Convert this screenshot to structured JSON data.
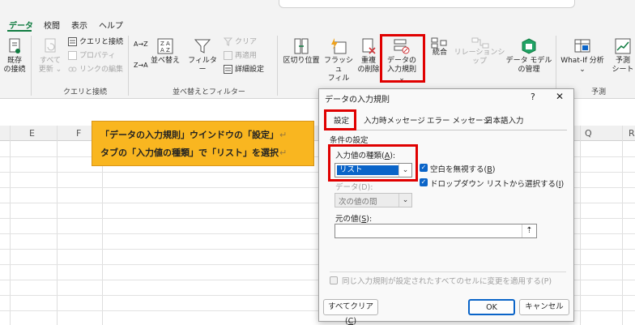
{
  "search": {
    "placeholder": ""
  },
  "tabs": [
    {
      "label": "データ",
      "active": true
    },
    {
      "label": "校閲"
    },
    {
      "label": "表示"
    },
    {
      "label": "ヘルプ"
    }
  ],
  "ribbon": {
    "existing": {
      "line1": "既存",
      "line2": "の接続"
    },
    "refresh_all": {
      "line1": "すべて",
      "line2": "更新 ⌄"
    },
    "queries_connections": "クエリと接続",
    "properties": "プロパティ",
    "edit_links": "リンクの編集",
    "group_queries": "クエリと接続",
    "sort_az": "A→Z",
    "sort_za": "Z→A",
    "sort": "並べ替え",
    "filter": "フィルター",
    "clear": "クリア",
    "reapply": "再適用",
    "advanced": "詳細設定",
    "group_sort": "並べ替えとフィルター",
    "text_to_columns": "区切り位置",
    "flash_fill": {
      "line1": "フラッシュ",
      "line2": "フィル"
    },
    "remove_dup": {
      "line1": "重複",
      "line2": "の削除"
    },
    "data_validation": {
      "line1": "データの",
      "line2": "入力規則 ⌄"
    },
    "consolidate": "統合",
    "relationships": "リレーションシップ",
    "data_model": {
      "line1": "データ モデル",
      "line2": "の管理"
    },
    "whatif": {
      "line1": "What-If 分析",
      "line2": "⌄"
    },
    "forecast": {
      "line1": "予測",
      "line2": "シート"
    },
    "group_forecast": "予測"
  },
  "columns": [
    "E",
    "F",
    "Q",
    "R"
  ],
  "callout": {
    "line1": "「データの入力規則」ウインドウの「設定」",
    "line2": "タブの「入力値の種類」で「リスト」を選択",
    "return_mark": "↵"
  },
  "dialog": {
    "title": "データの入力規則",
    "help": "?",
    "close": "✕",
    "tabs": [
      "設定",
      "入力時メッセージ",
      "エラー メッセージ",
      "日本語入力"
    ],
    "section": "条件の設定",
    "allow_label": "入力値の種類(",
    "allow_key": "A",
    "allow_suffix": "):",
    "allow_value": "リスト",
    "ignore_blank": "空白を無視する(",
    "ignore_blank_key": "B",
    "in_cell_dropdown": "ドロップダウン リストから選択する(",
    "in_cell_dropdown_key": "I",
    "data_label": "データ(D):",
    "data_value": "次の値の間",
    "source_label": "元の値(",
    "source_key": "S",
    "source_value": "",
    "apply_all": "同じ入力規則が設定されたすべてのセルに変更を適用する(P)",
    "clear_all": "すべてクリア(",
    "clear_all_key": "C",
    "ok": "OK",
    "cancel": "キャンセル"
  },
  "colors": {
    "accent": "#107c41",
    "highlight": "#e00000",
    "callout": "#f9b620",
    "selection": "#0a64c8"
  }
}
